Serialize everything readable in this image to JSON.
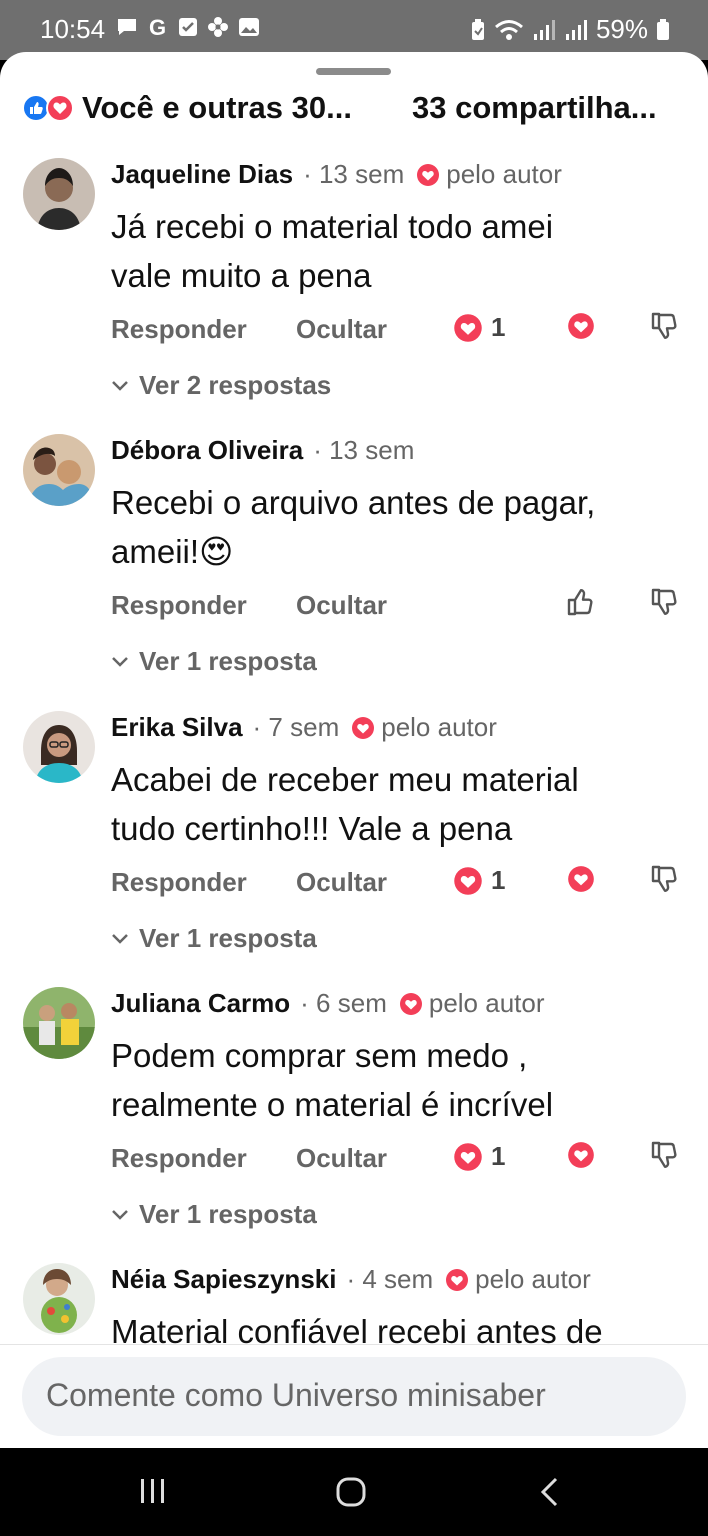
{
  "status_bar": {
    "time": "10:54",
    "battery": "59%"
  },
  "header": {
    "reactions_text": "Você e outras 30...",
    "shares_text": "33 compartilha..."
  },
  "comments": [
    {
      "name": "Jaqueline Dias",
      "time": "· 13 sem",
      "author_badge": "pelo autor",
      "text_line1": "Já recebi  o material  todo amei",
      "text_line2": "vale muito a pena",
      "reply_label": "Responder",
      "hide_label": "Ocultar",
      "reaction_count": "1",
      "replies_label": "Ver 2 respostas"
    },
    {
      "name": "Débora Oliveira",
      "time": "· 13 sem",
      "text_line1": "Recebi o arquivo antes de pagar,",
      "text_line2": "ameii!",
      "emoji": "😍",
      "reply_label": "Responder",
      "hide_label": "Ocultar",
      "replies_label": "Ver 1 resposta"
    },
    {
      "name": "Erika Silva",
      "time": "· 7 sem",
      "author_badge": "pelo autor",
      "text_line1": "Acabei de receber meu material",
      "text_line2": "tudo certinho!!! Vale a pena",
      "reply_label": "Responder",
      "hide_label": "Ocultar",
      "reaction_count": "1",
      "replies_label": "Ver 1 resposta"
    },
    {
      "name": "Juliana Carmo",
      "time": "· 6 sem",
      "author_badge": "pelo autor",
      "text_line1": "Podem comprar sem medo ,",
      "text_line2": "realmente o material é incrível",
      "reply_label": "Responder",
      "hide_label": "Ocultar",
      "reaction_count": "1",
      "replies_label": "Ver 1 resposta"
    },
    {
      "name": "Néia Sapieszynski",
      "time": "· 4 sem",
      "author_badge": "pelo autor",
      "text_line1": "Material confiável recebi antes de"
    }
  ],
  "compose": {
    "placeholder": "Comente como Universo minisaber"
  },
  "colors": {
    "love": "#f33e58",
    "like": "#1877f2",
    "secondary_text": "#656565"
  }
}
